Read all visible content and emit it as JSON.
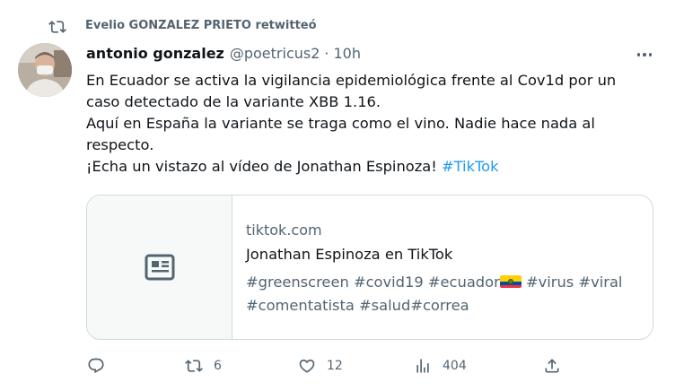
{
  "retweet": {
    "icon": "retweet-icon",
    "text": "Evelio GONZALEZ PRIETO retwitteó"
  },
  "tweet": {
    "author_name": "antonio gonzalez",
    "handle": "@poetricus2",
    "separator": "·",
    "time": "10h",
    "lines": [
      "En Ecuador se activa la vigilancia epidemiológica frente al Cov1d por un",
      "caso detectado de la variante XBB 1.16.",
      "Aquí en España la variante se traga como el vino. Nadie hace nada al",
      "respecto.",
      "¡Echa un vistazo al vídeo de Jonathan Espinoza! "
    ],
    "hashtag": "#TikTok"
  },
  "card": {
    "icon": "article-icon",
    "domain": "tiktok.com",
    "title": "Jonathan Espinoza en TikTok",
    "desc_line1_a": "#greenscreen #covid19 #ecuador",
    "flag": "ecuador-flag",
    "desc_line1_b": " #virus #viral",
    "desc_line2": "#comentatista #salud#correa"
  },
  "actions": {
    "reply": {
      "icon": "reply-icon"
    },
    "retweet": {
      "icon": "retweet-icon",
      "count": "6"
    },
    "like": {
      "icon": "heart-icon",
      "count": "12"
    },
    "views": {
      "icon": "views-icon",
      "count": "404"
    },
    "share": {
      "icon": "share-icon"
    }
  },
  "colors": {
    "text": "#0f1419",
    "secondary": "#536471",
    "link": "#1d9bf0",
    "border": "#cfd9de"
  }
}
